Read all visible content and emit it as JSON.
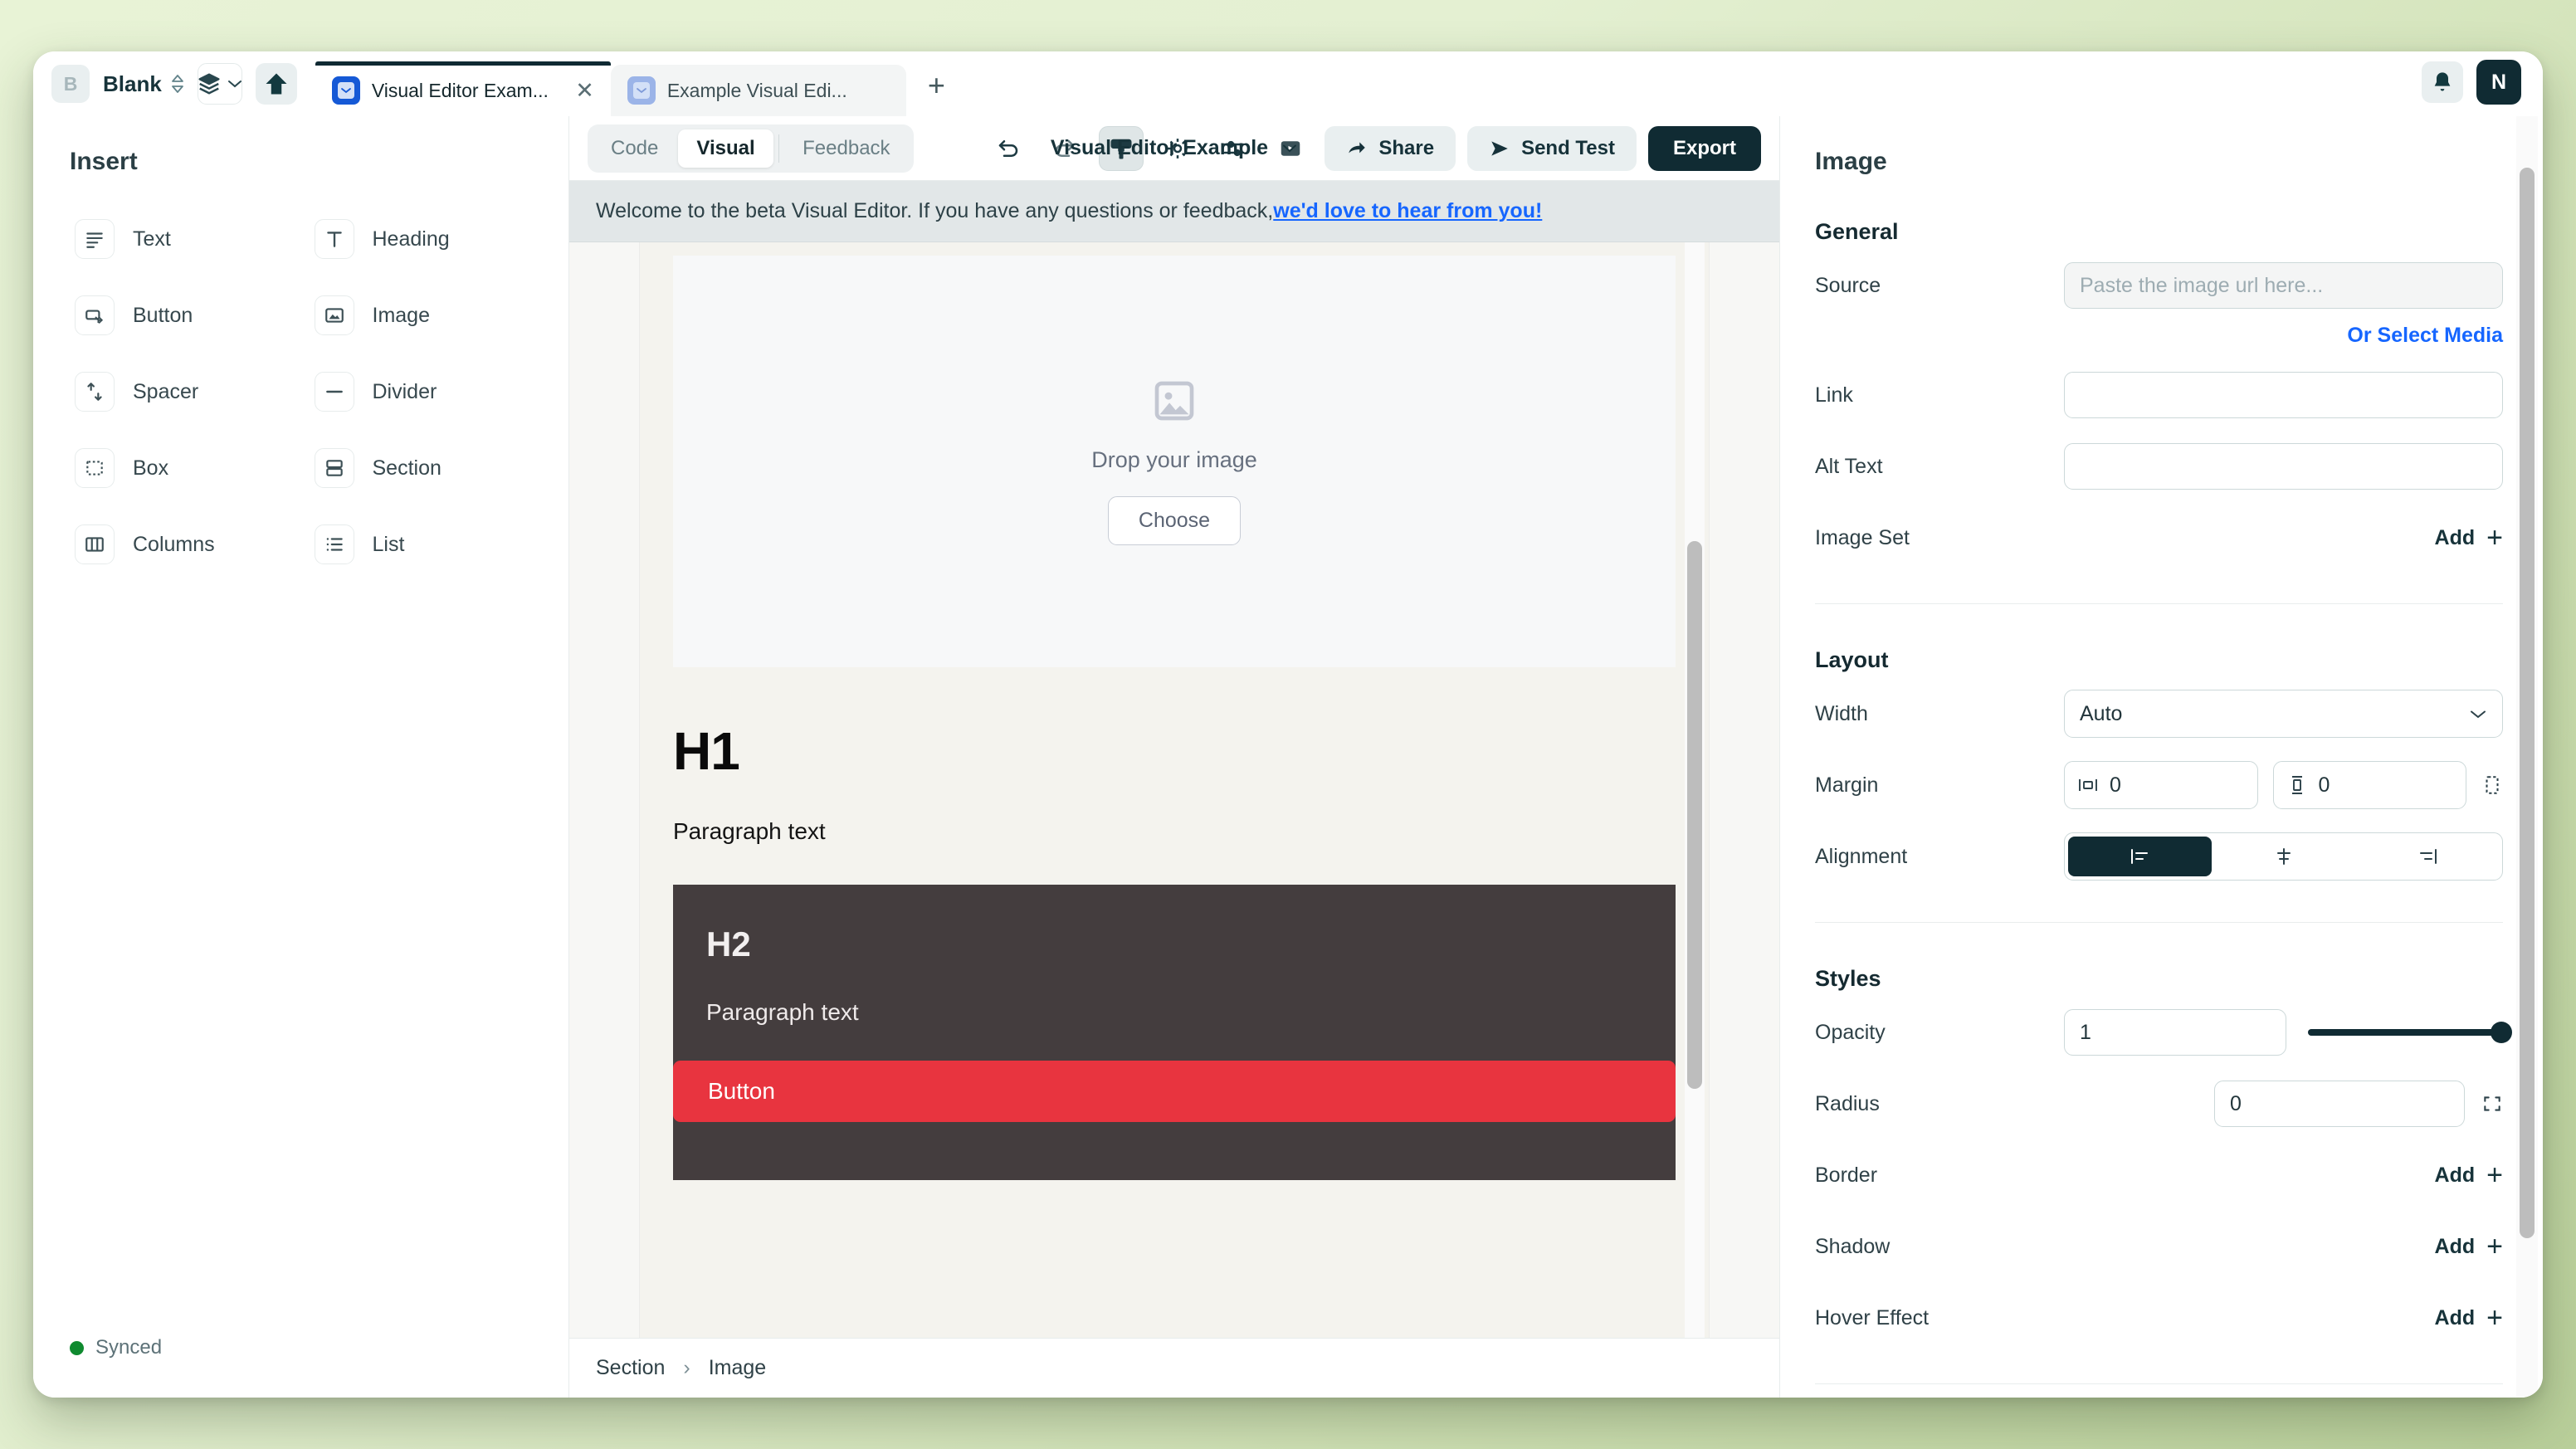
{
  "browser": {
    "brand_badge": "B",
    "workspace_name": "Blank",
    "tabs": [
      {
        "label": "Visual Editor Exam...",
        "active": true,
        "close_label": "✕"
      },
      {
        "label": "Example Visual Edi...",
        "active": false
      }
    ],
    "new_tab_label": "+",
    "avatar_initial": "N"
  },
  "sidebar": {
    "title": "Insert",
    "items": [
      {
        "label": "Text",
        "icon": "text-lines-icon"
      },
      {
        "label": "Heading",
        "icon": "heading-t-icon"
      },
      {
        "label": "Button",
        "icon": "button-icon"
      },
      {
        "label": "Image",
        "icon": "image-icon"
      },
      {
        "label": "Spacer",
        "icon": "spacer-arrows-icon"
      },
      {
        "label": "Divider",
        "icon": "divider-line-icon"
      },
      {
        "label": "Box",
        "icon": "dashed-box-icon"
      },
      {
        "label": "Section",
        "icon": "section-icon"
      },
      {
        "label": "Columns",
        "icon": "columns-icon"
      },
      {
        "label": "List",
        "icon": "list-icon"
      }
    ],
    "status": "Synced",
    "status_color": "#0f8a2f"
  },
  "toolbar": {
    "modes": [
      {
        "label": "Code",
        "active": false
      },
      {
        "label": "Visual",
        "active": true
      },
      {
        "label": "Feedback",
        "active": false
      }
    ],
    "document_title": "Visual Editor Example",
    "icons": [
      {
        "name": "undo-icon",
        "active": false
      },
      {
        "name": "redo-icon",
        "active": false
      },
      {
        "name": "paintbrush-icon",
        "active": true
      },
      {
        "name": "gear-icon",
        "active": false
      },
      {
        "name": "sliders-icon",
        "active": false
      },
      {
        "name": "preview-play-icon",
        "active": false
      }
    ],
    "share_label": "Share",
    "send_test_label": "Send Test",
    "export_label": "Export"
  },
  "banner": {
    "text": "Welcome to the beta Visual Editor. If you have any questions or feedback, ",
    "link": "we'd love to hear from you!",
    "link_color": "#1666ff"
  },
  "canvas": {
    "dropzone": {
      "text": "Drop your image",
      "button": "Choose",
      "icon": "image-placeholder-icon"
    },
    "heading1": "H1",
    "paragraph1": "Paragraph text",
    "section": {
      "heading2": "H2",
      "paragraph": "Paragraph text",
      "button": "Button",
      "button_color": "#e8343f",
      "background": "#443d3e"
    }
  },
  "breadcrumb": {
    "items": [
      "Section",
      "Image"
    ],
    "separator": "›"
  },
  "properties": {
    "title": "Image",
    "sections": [
      {
        "heading": "General"
      },
      {
        "heading": "Layout"
      },
      {
        "heading": "Styles"
      }
    ],
    "general": {
      "source_label": "Source",
      "source_value": "",
      "source_placeholder": "Paste the image url here...",
      "select_media_link": "Or Select Media",
      "link_label": "Link",
      "link_value": "",
      "alt_text_label": "Alt Text",
      "alt_text_value": "",
      "image_set_label": "Image Set",
      "image_set_action": "Add"
    },
    "layout": {
      "width_label": "Width",
      "width_value": "Auto",
      "margin_label": "Margin",
      "margin_horizontal": "0",
      "margin_vertical": "0",
      "alignment_label": "Alignment",
      "alignment_options": [
        "left",
        "center",
        "right"
      ],
      "alignment_selected": "left"
    },
    "styles": {
      "opacity_label": "Opacity",
      "opacity_value": "1",
      "opacity_percent": 100,
      "radius_label": "Radius",
      "radius_value": "0",
      "border_label": "Border",
      "border_action": "Add",
      "shadow_label": "Shadow",
      "shadow_action": "Add",
      "hover_label": "Hover Effect",
      "hover_action": "Add"
    }
  }
}
